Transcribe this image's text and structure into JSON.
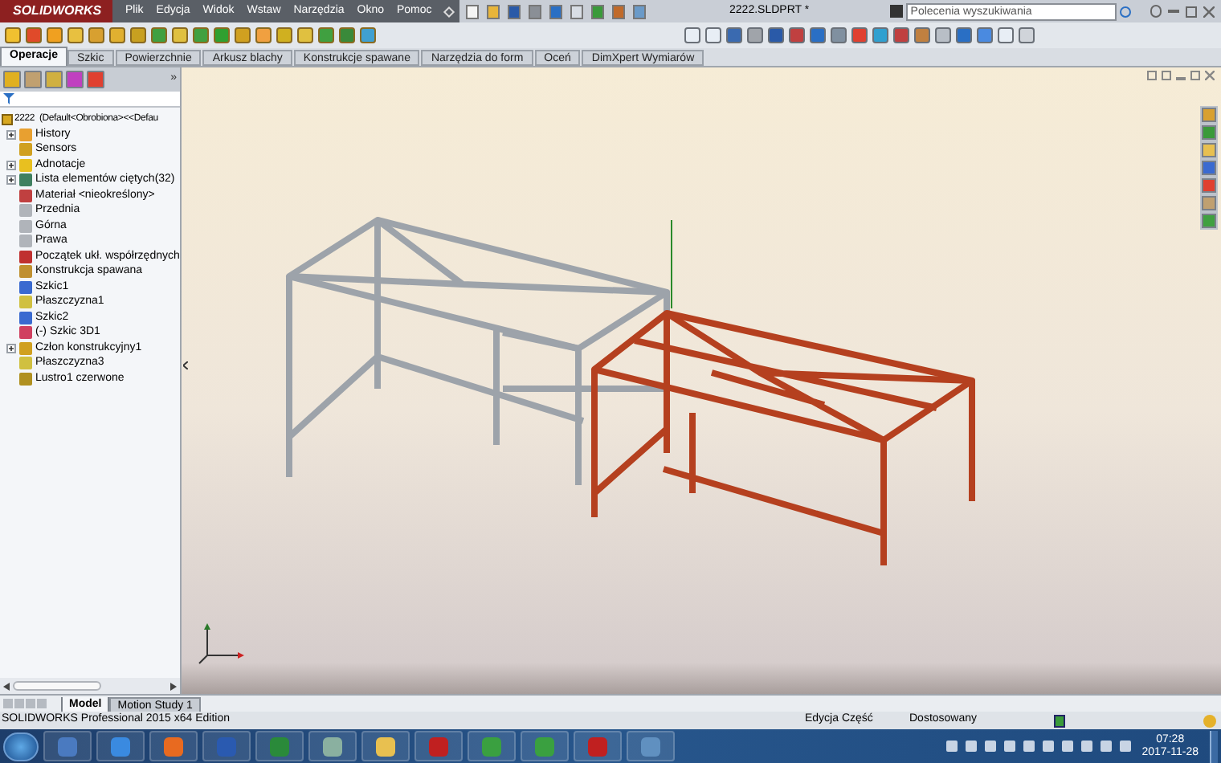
{
  "app": {
    "logo": "SOLIDWORKS",
    "menu": [
      "Plik",
      "Edycja",
      "Widok",
      "Wstaw",
      "Narzędzia",
      "Okno",
      "Pomoc"
    ],
    "document_title": "2222.SLDPRT *",
    "search": {
      "placeholder": "Polecenia wyszukiwania"
    }
  },
  "command_tabs": [
    {
      "label": "Operacje",
      "selected": true
    },
    {
      "label": "Szkic",
      "selected": false
    },
    {
      "label": "Powierzchnie",
      "selected": false
    },
    {
      "label": "Arkusz blachy",
      "selected": false
    },
    {
      "label": "Konstrukcje spawane",
      "selected": false
    },
    {
      "label": "Narzędzia do form",
      "selected": false
    },
    {
      "label": "Oceń",
      "selected": false
    },
    {
      "label": "DimXpert Wymiarów",
      "selected": false
    }
  ],
  "feature_tree": {
    "more": "»",
    "root": "2222  (Default<Obrobiona><<Defau",
    "items": [
      {
        "label": "History",
        "kind": "group"
      },
      {
        "label": "Sensors",
        "kind": "item"
      },
      {
        "label": "Adnotacje",
        "kind": "group"
      },
      {
        "label": "Lista elementów ciętych(32)",
        "kind": "group"
      },
      {
        "label": "Materiał <nieokreślony>",
        "kind": "item"
      },
      {
        "label": "Przednia",
        "kind": "item"
      },
      {
        "label": "Górna",
        "kind": "item"
      },
      {
        "label": "Prawa",
        "kind": "item"
      },
      {
        "label": "Początek ukł. współrzędnych",
        "kind": "item"
      },
      {
        "label": "Konstrukcja spawana",
        "kind": "item"
      },
      {
        "label": "Szkic1",
        "kind": "item"
      },
      {
        "label": "Płaszczyzna1",
        "kind": "item"
      },
      {
        "label": "Szkic2",
        "kind": "item"
      },
      {
        "label": "(-) Szkic 3D1",
        "kind": "item"
      },
      {
        "label": "Człon konstrukcyjny1",
        "kind": "group"
      },
      {
        "label": "Płaszczyzna3",
        "kind": "item"
      },
      {
        "label": "Lustro1 czerwone",
        "kind": "item"
      }
    ]
  },
  "bottom_tabs": [
    {
      "label": "Model",
      "selected": true
    },
    {
      "label": "Motion Study 1",
      "selected": false
    }
  ],
  "status_bar": {
    "edition": "SOLIDWORKS Professional 2015 x64 Edition",
    "mode": "Edycja Część",
    "units": "Dostosowany"
  },
  "taskbar": {
    "time": "07:28",
    "date": "2017-11-28"
  }
}
